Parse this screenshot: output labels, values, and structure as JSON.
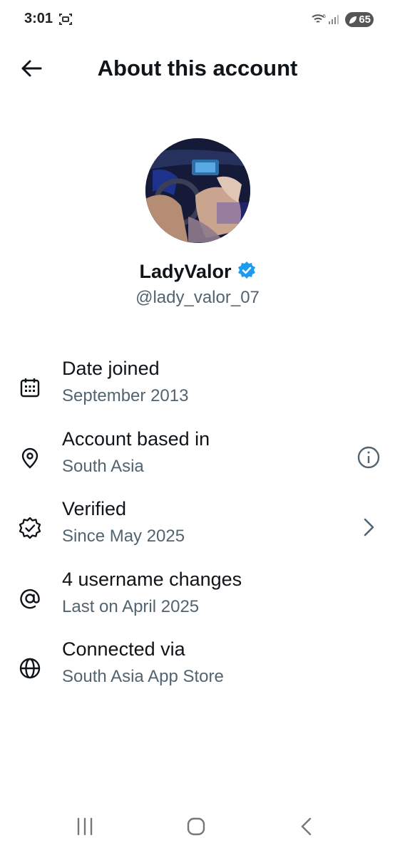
{
  "status_bar": {
    "time": "3:01",
    "battery": "65"
  },
  "header": {
    "title": "About this account"
  },
  "profile": {
    "display_name": "LadyValor",
    "handle": "@lady_valor_07",
    "verified_color": "#1d9bf0"
  },
  "rows": [
    {
      "title": "Date joined",
      "subtitle": "September 2013",
      "icon": "calendar-icon"
    },
    {
      "title": "Account based in",
      "subtitle": "South Asia",
      "icon": "location-pin-icon",
      "trailing": "info-icon"
    },
    {
      "title": "Verified",
      "subtitle": "Since May 2025",
      "icon": "verified-badge-icon",
      "trailing": "chevron-right-icon"
    },
    {
      "title": "4 username changes",
      "subtitle": "Last on April 2025",
      "icon": "at-sign-icon"
    },
    {
      "title": "Connected via",
      "subtitle": "South Asia App Store",
      "icon": "globe-icon"
    }
  ],
  "colors": {
    "text_primary": "#0f1419",
    "text_secondary": "#536471",
    "verified": "#1d9bf0"
  }
}
